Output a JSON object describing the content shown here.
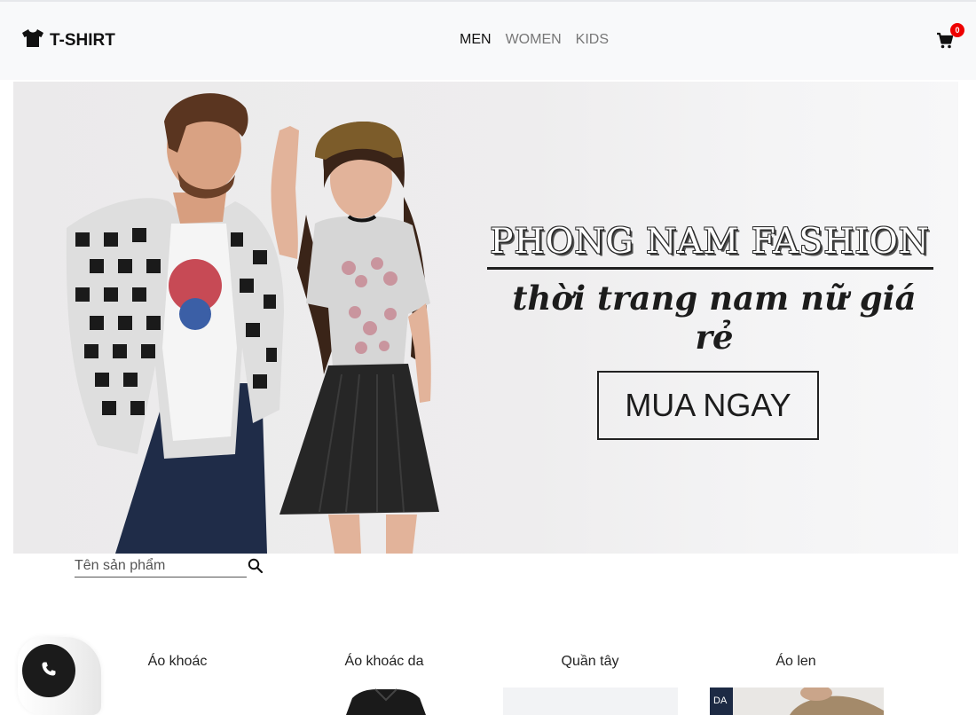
{
  "brand": {
    "name": "T-SHIRT",
    "icon": "tshirt-icon"
  },
  "nav": {
    "items": [
      {
        "label": "MEN",
        "active": true
      },
      {
        "label": "WOMEN",
        "active": false
      },
      {
        "label": "KIDS",
        "active": false
      }
    ]
  },
  "cart": {
    "icon": "cart-icon",
    "count": "0"
  },
  "hero": {
    "title": "PHONG NAM FASHION",
    "subtitle": "thời trang nam nữ giá rẻ",
    "cta": "MUA NGAY"
  },
  "search": {
    "placeholder": "Tên sản phẩm",
    "value": "",
    "icon": "search-icon"
  },
  "categories": [
    {
      "label": "Áo khoác"
    },
    {
      "label": "Áo khoác da"
    },
    {
      "label": "Quần tây"
    },
    {
      "label": "Áo len"
    }
  ],
  "contact": {
    "icon": "phone-icon"
  },
  "colors": {
    "accent": "#e00000",
    "dark": "#1b1b1b",
    "header_bg": "#f8f9fa"
  }
}
